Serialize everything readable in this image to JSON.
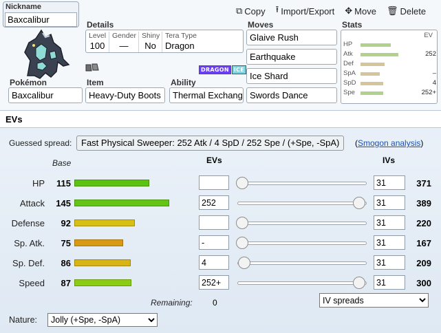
{
  "toolbar": {
    "copy": "Copy",
    "import_export": "Import/Export",
    "move": "Move",
    "delete": "Delete"
  },
  "nickname": {
    "label": "Nickname",
    "value": "Baxcalibur"
  },
  "details": {
    "title": "Details",
    "level_k": "Level",
    "level_v": "100",
    "gender_k": "Gender",
    "gender_v": "—",
    "shiny_k": "Shiny",
    "shiny_v": "No",
    "tera_k": "Tera Type",
    "tera_v": "Dragon"
  },
  "types": [
    "DRAGON",
    "ICE"
  ],
  "type_colors": {
    "DRAGON": "#6a3ff0",
    "ICE": "#7fd4e0"
  },
  "pokemon": {
    "label": "Pokémon",
    "value": "Baxcalibur"
  },
  "item": {
    "label": "Item",
    "value": "Heavy-Duty Boots"
  },
  "ability": {
    "label": "Ability",
    "value": "Thermal Exchang"
  },
  "moves": {
    "title": "Moves",
    "list": [
      "Glaive Rush",
      "Earthquake",
      "Ice Shard",
      "Swords Dance"
    ]
  },
  "stats_mini": {
    "title": "Stats",
    "ev_header": "EV",
    "rows": [
      {
        "label": "HP",
        "ev": "",
        "base": 115
      },
      {
        "label": "Atk",
        "ev": "252",
        "base": 145
      },
      {
        "label": "Def",
        "ev": "",
        "base": 92
      },
      {
        "label": "SpA",
        "ev": "–",
        "base": 75
      },
      {
        "label": "SpD",
        "ev": "4",
        "base": 86
      },
      {
        "label": "Spe",
        "ev": "252+",
        "base": 87
      }
    ]
  },
  "evs_section": {
    "title": "EVs",
    "guessed_label": "Guessed spread:",
    "guessed_value": "Fast Physical Sweeper: 252 Atk / 4 SpD / 252 Spe / (+Spe, -SpA)",
    "smogon_link": "Smogon analysis",
    "col_base": "Base",
    "col_evs": "EVs",
    "col_ivs": "IVs",
    "stats": [
      {
        "name": "HP",
        "base": "115",
        "ev": "",
        "iv": "31",
        "total": "371",
        "color": "#5cc313",
        "ev_value": 0
      },
      {
        "name": "Attack",
        "base": "145",
        "ev": "252",
        "iv": "31",
        "total": "389",
        "color": "#63c516",
        "ev_value": 252
      },
      {
        "name": "Defense",
        "base": "92",
        "ev": "",
        "iv": "31",
        "total": "220",
        "color": "#d8bf14",
        "ev_value": 0
      },
      {
        "name": "Sp. Atk.",
        "base": "75",
        "ev": "-",
        "iv": "31",
        "total": "167",
        "color": "#d89a14",
        "ev_value": 0
      },
      {
        "name": "Sp. Def.",
        "base": "86",
        "ev": "4",
        "iv": "31",
        "total": "209",
        "color": "#d8b514",
        "ev_value": 4
      },
      {
        "name": "Speed",
        "base": "87",
        "ev": "252+",
        "iv": "31",
        "total": "300",
        "color": "#8ccc14",
        "ev_value": 252
      }
    ],
    "remaining_label": "Remaining:",
    "remaining_value": "0",
    "iv_spreads": "IV spreads",
    "nature_label": "Nature:",
    "nature_value": "Jolly (+Spe, -SpA)"
  }
}
